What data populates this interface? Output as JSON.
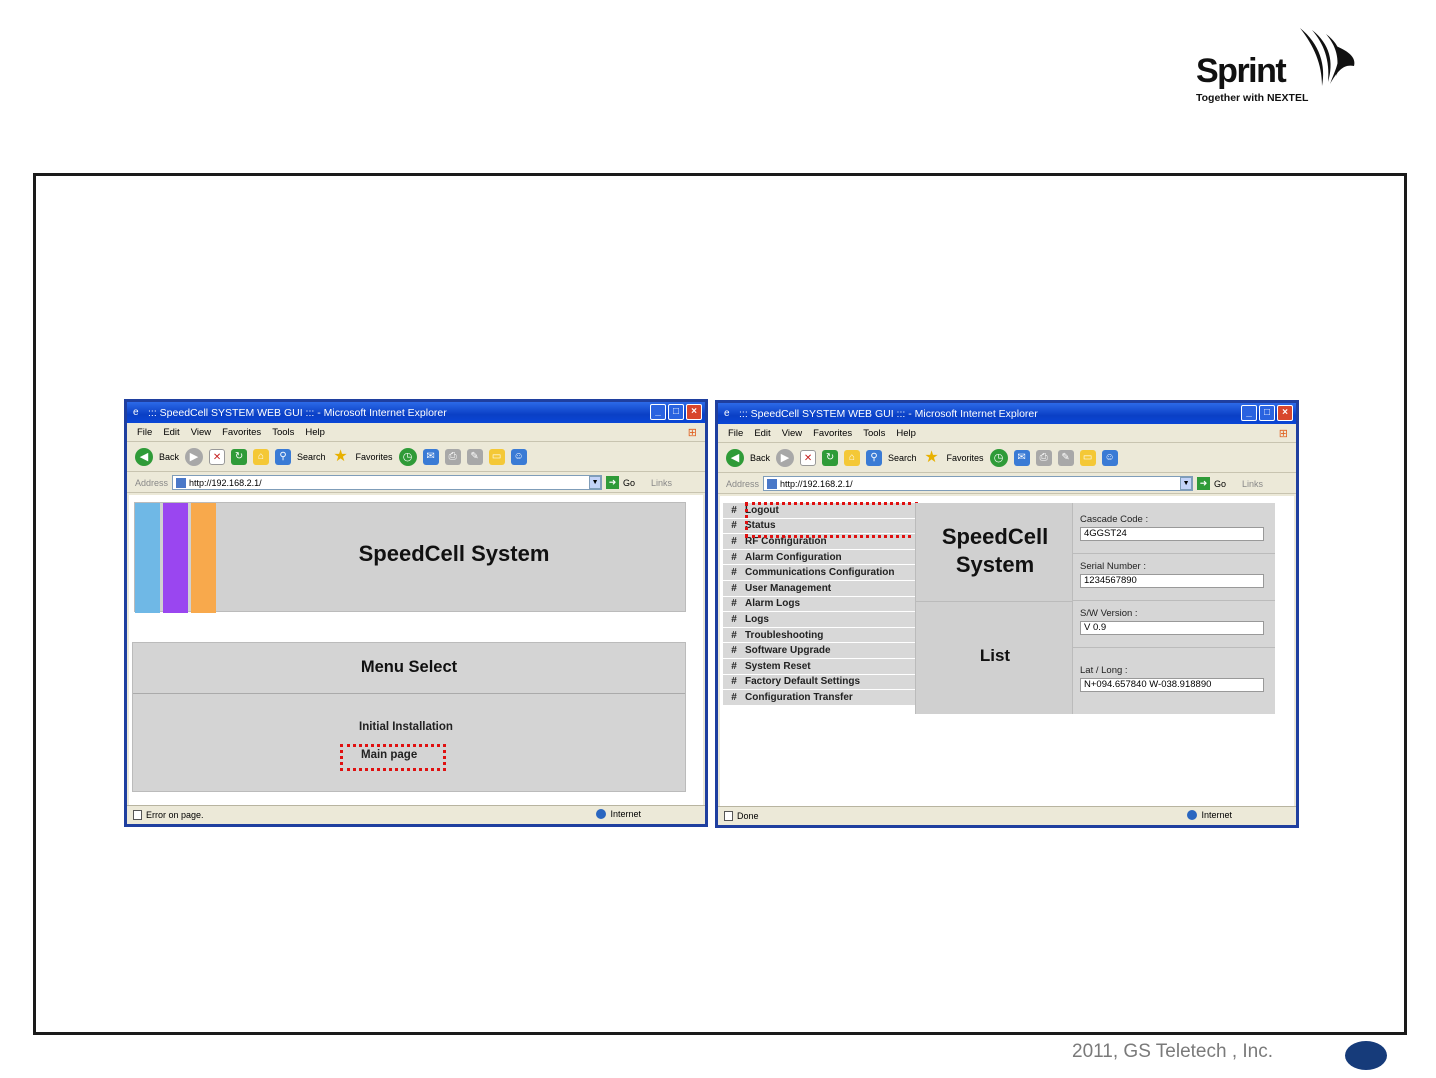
{
  "logo": {
    "word": "Sprint",
    "tagline": "Together with NEXTEL"
  },
  "footer": {
    "copyright": "2011, GS Teletech , Inc."
  },
  "colors": {
    "stripe_blue": "#6fb8e6",
    "stripe_purple": "#9a46f0",
    "stripe_orange": "#f8a94c",
    "highlight_red": "#e01010",
    "frame": "#1a1a1a",
    "page_dot": "#163b7a"
  },
  "browser_left": {
    "title": "::: SpeedCell SYSTEM WEB GUI ::: - Microsoft Internet Explorer",
    "menu": [
      "File",
      "Edit",
      "View",
      "Favorites",
      "Tools",
      "Help"
    ],
    "toolbar": {
      "back": "Back",
      "search": "Search",
      "favorites": "Favorites",
      "go": "Go",
      "links": "Links",
      "address_label": "Address"
    },
    "address": "http://192.168.2.1/",
    "status": "Error on page.",
    "zone": "Internet",
    "page": {
      "banner_title": "SpeedCell System",
      "menu_title": "Menu Select",
      "menu_items": [
        "Initial Installation",
        "Main page"
      ]
    }
  },
  "browser_right": {
    "title": "::: SpeedCell SYSTEM WEB GUI ::: - Microsoft Internet Explorer",
    "menu": [
      "File",
      "Edit",
      "View",
      "Favorites",
      "Tools",
      "Help"
    ],
    "toolbar": {
      "back": "Back",
      "search": "Search",
      "favorites": "Favorites",
      "go": "Go",
      "links": "Links",
      "address_label": "Address"
    },
    "address": "http://192.168.2.1/",
    "status": "Done",
    "zone": "Internet",
    "page": {
      "nav_marker": "#",
      "nav": [
        "Logout",
        "Status",
        "RF Configuration",
        "Alarm Configuration",
        "Communications Configuration",
        "User Management",
        "Alarm Logs",
        "Logs",
        "Troubleshooting",
        "Software Upgrade",
        "System Reset",
        "Factory Default Settings",
        "Configuration Transfer"
      ],
      "title_line1": "SpeedCell",
      "title_line2": "System",
      "list_label": "List",
      "fields": [
        {
          "label": "Cascade Code :",
          "value": "4GGST24"
        },
        {
          "label": "Serial Number :",
          "value": "1234567890"
        },
        {
          "label": "S/W Version :",
          "value": "V 0.9"
        },
        {
          "label": "Lat / Long :",
          "value": "N+094.657840 W-038.918890"
        }
      ]
    }
  }
}
